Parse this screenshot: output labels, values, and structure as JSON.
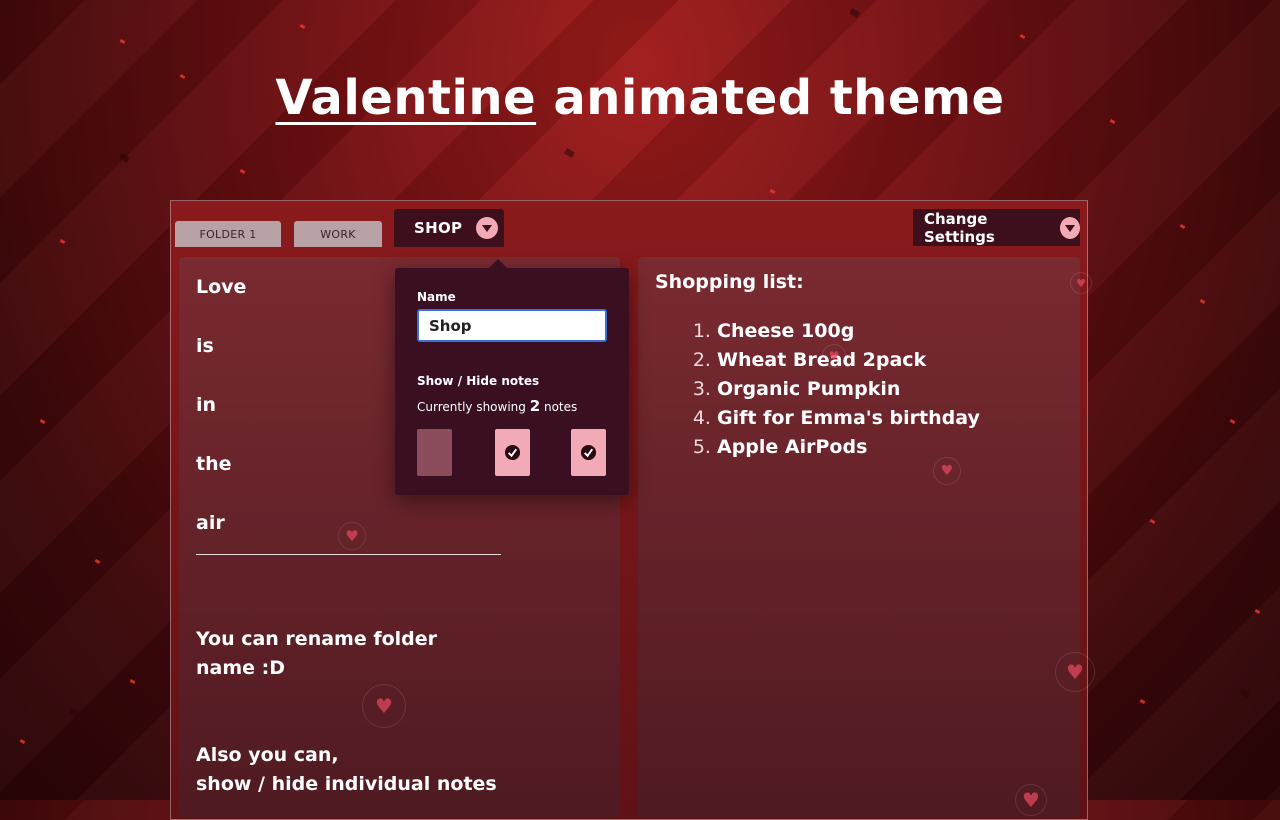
{
  "headline": {
    "part1": "Valentine",
    "part2": "animated theme"
  },
  "tabs": [
    {
      "label": "FOLDER 1"
    },
    {
      "label": "WORK"
    },
    {
      "label": "SHOP"
    }
  ],
  "settings_label": "Change Settings",
  "left_note": {
    "lines": [
      "Love",
      "is",
      "in",
      "the",
      "air"
    ],
    "para1": [
      "You can rename folder",
      "name :D"
    ],
    "para2": [
      "Also you can,",
      "show / hide individual notes"
    ]
  },
  "right_note": {
    "title": "Shopping list:",
    "items": [
      "Cheese 100g",
      "Wheat Bread 2pack",
      "Organic Pumpkin",
      "Gift for Emma's birthday",
      "Apple AirPods"
    ]
  },
  "popup": {
    "name_label": "Name",
    "name_value": "Shop",
    "show_hide_label": "Show / Hide notes",
    "currently_prefix": "Currently showing",
    "count": "2",
    "currently_suffix": "notes",
    "notes_visible": [
      false,
      true,
      true
    ]
  },
  "colors": {
    "accent": "#f2aab6",
    "panel": "#3a0f22",
    "input_border": "#3b6fd9"
  }
}
